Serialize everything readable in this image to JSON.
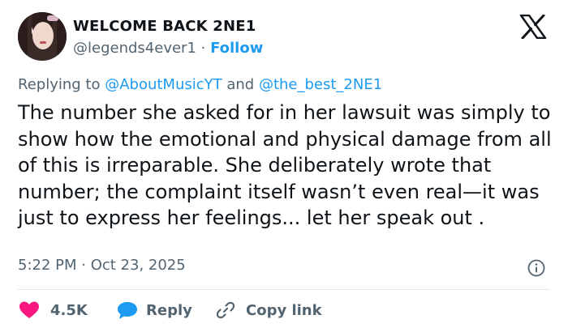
{
  "user": {
    "display_name": "WELCOME BACK 2NE1",
    "handle": "@legends4ever1",
    "separator": " · ",
    "follow_label": "Follow"
  },
  "reply": {
    "prefix": "Replying to ",
    "mention_1": "@AboutMusicYT",
    "joiner": " and ",
    "mention_2": "@the_best_2NE1"
  },
  "tweet": {
    "text": "The number she asked for in her lawsuit was simply to show how the emotional and physical damage from all of this is irreparable. She deliberately wrote that number; the complaint itself wasn’t even real—it was just to express her feelings... let her speak out ."
  },
  "meta": {
    "timestamp": "5:22 PM · Oct 23, 2025"
  },
  "actions": {
    "like_count": "4.5K",
    "reply_label": "Reply",
    "copy_link_label": "Copy link"
  },
  "icons": {
    "logo": "x-logo-icon",
    "info": "info-icon",
    "like": "heart-icon",
    "reply": "speech-bubble-icon",
    "copy_link": "link-icon"
  },
  "colors": {
    "text": "#0f1419",
    "secondary": "#536471",
    "accent": "#1d9bf0",
    "like": "#f91880",
    "divider": "#e1e8ed"
  }
}
